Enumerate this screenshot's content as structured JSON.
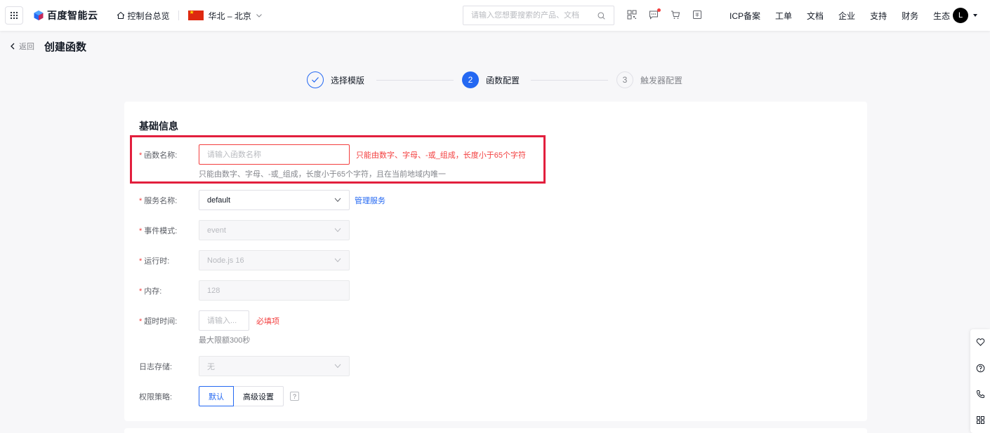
{
  "topbar": {
    "logo_text": "百度智能云",
    "console_label": "控制台总览",
    "region": "华北 – 北京",
    "search_placeholder": "请输入您想要搜索的产品、文档",
    "nav_links": [
      "ICP备案",
      "工单",
      "文档",
      "企业",
      "支持",
      "财务",
      "生态"
    ],
    "avatar_letter": "L"
  },
  "page": {
    "back_label": "返回",
    "title": "创建函数"
  },
  "steps": [
    {
      "label": "选择模版",
      "state": "done",
      "number": "1"
    },
    {
      "label": "函数配置",
      "state": "active",
      "number": "2"
    },
    {
      "label": "触发器配置",
      "state": "wait",
      "number": "3"
    }
  ],
  "form": {
    "section_title": "基础信息",
    "function_name": {
      "label": "函数名称:",
      "placeholder": "请输入函数名称",
      "value": "",
      "error": "只能由数字、字母、-或_组成，长度小于65个字符",
      "hint": "只能由数字、字母、-或_组成，长度小于65个字符，且在当前地域内唯一"
    },
    "service_name": {
      "label": "服务名称:",
      "value": "default",
      "link": "管理服务"
    },
    "event_mode": {
      "label": "事件模式:",
      "value": "event"
    },
    "runtime": {
      "label": "运行时:",
      "value": "Node.js 16"
    },
    "memory": {
      "label": "内存:",
      "value": "128"
    },
    "timeout": {
      "label": "超时时间:",
      "placeholder": "请输入...",
      "value": "",
      "error": "必填项",
      "hint": "最大限额300秒"
    },
    "log_storage": {
      "label": "日志存储:",
      "value": "无"
    },
    "permission": {
      "label": "权限策略:",
      "options": [
        "默认",
        "高级设置"
      ],
      "selected": "默认",
      "help": "?"
    }
  },
  "required_marker": "*",
  "colors": {
    "primary": "#2468f2",
    "error": "#f33e3e",
    "highlight_box": "#e21f3d"
  },
  "float_tools": [
    "heart-icon",
    "help-icon",
    "phone-icon",
    "apps-icon"
  ]
}
